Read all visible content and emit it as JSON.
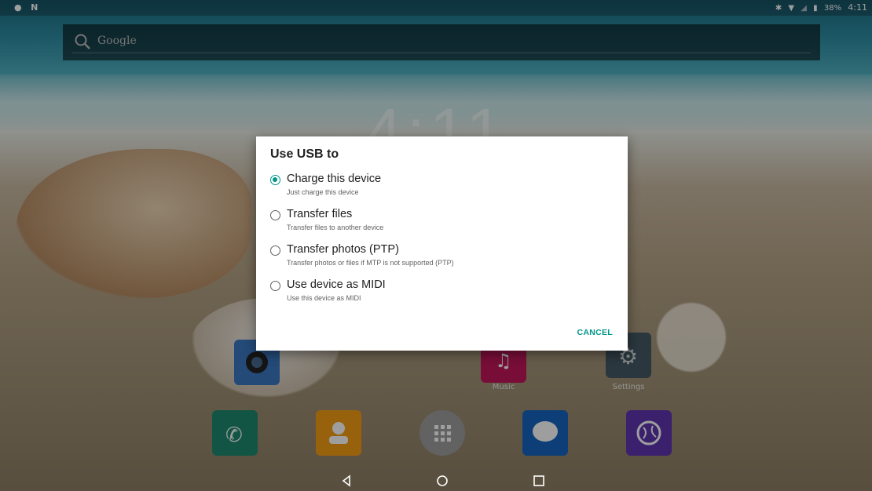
{
  "status_bar": {
    "time": "4:11",
    "battery": "38%",
    "icons_left": [
      "notification-dot-icon",
      "n-icon"
    ],
    "icons_right": [
      "bluetooth-icon",
      "wifi-icon",
      "signal-icon",
      "battery-icon"
    ]
  },
  "search": {
    "placeholder": "Google",
    "icon": "search-icon"
  },
  "clock": {
    "text": "4:11"
  },
  "apps_row": [
    {
      "name": "Camera",
      "label": "",
      "color": "#3b78c2"
    },
    {
      "name": "Music",
      "label": "Music",
      "color": "#c2185b"
    },
    {
      "name": "Settings",
      "label": "Settings",
      "color": "#455a64"
    }
  ],
  "dock": [
    {
      "name": "phone",
      "color": "#1f8a6e"
    },
    {
      "name": "contacts",
      "color": "#f59f16"
    },
    {
      "name": "all-apps",
      "color": "#9e9e9e"
    },
    {
      "name": "messaging",
      "color": "#1565c0"
    },
    {
      "name": "browser",
      "color": "#5e35b1"
    }
  ],
  "dialog": {
    "title": "Use USB to",
    "options": [
      {
        "title": "Charge this device",
        "subtitle": "Just charge this device",
        "selected": true
      },
      {
        "title": "Transfer files",
        "subtitle": "Transfer files to another device",
        "selected": false
      },
      {
        "title": "Transfer photos (PTP)",
        "subtitle": "Transfer photos or files if MTP is not supported (PTP)",
        "selected": false
      },
      {
        "title": "Use device as MIDI",
        "subtitle": "Use this device as MIDI",
        "selected": false
      }
    ],
    "cancel_label": "CANCEL",
    "accent_color": "#009688"
  },
  "navigation": {
    "buttons": [
      "back-icon",
      "home-icon",
      "recents-icon"
    ]
  }
}
